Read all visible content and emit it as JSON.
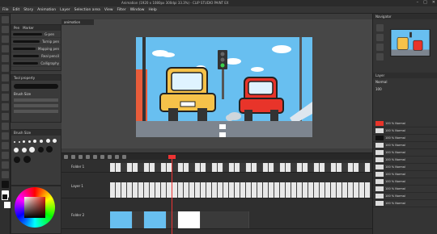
{
  "titlebar": {
    "title": "Animation (1920 x 1080px 300dpi 33.3%) - CLIP STUDIO PAINT EX"
  },
  "menu": [
    "File",
    "Edit",
    "Story",
    "Animation",
    "Layer",
    "Selection area",
    "View",
    "Filter",
    "Window",
    "Help"
  ],
  "window_controls": [
    "–",
    "□",
    "✕"
  ],
  "sub_tool": {
    "tabs": [
      "Pen",
      "Marker"
    ],
    "brushes": [
      {
        "name": "G-pen"
      },
      {
        "name": "Turnip pen"
      },
      {
        "name": "Mapping pen"
      },
      {
        "name": "Real pencil"
      },
      {
        "name": "Calligraphy"
      }
    ]
  },
  "tool_property": {
    "title": "Tool property",
    "brush_size_label": "Brush Size"
  },
  "brush_size_panel": {
    "title": "Brush Size"
  },
  "canvas": {
    "tab": "animation"
  },
  "timeline": {
    "tracks": [
      {
        "name": "Folder 1",
        "cells": "1-5 9 13 17"
      },
      {
        "name": "Layer 1",
        "cells": "1 4 7"
      },
      {
        "name": "Folder 2",
        "cells": "1 4 7"
      }
    ]
  },
  "navigator": {
    "title": "Navigator"
  },
  "layers": {
    "title": "Layer",
    "blend_mode": "Normal",
    "opacity": "100",
    "items": [
      {
        "name": "100 % Normal"
      },
      {
        "name": "100 % Normal"
      },
      {
        "name": "100 % Normal"
      },
      {
        "name": "100 % Normal"
      },
      {
        "name": "100 % Normal"
      },
      {
        "name": "100 % Normal"
      },
      {
        "name": "100 % Normal"
      },
      {
        "name": "100 % Normal"
      },
      {
        "name": "100 % Normal"
      },
      {
        "name": "100 % Normal"
      },
      {
        "name": "100 % Normal"
      },
      {
        "name": "100 % Normal"
      }
    ]
  },
  "colors": {
    "accent": "#e33333",
    "main_color": "#d21b1b"
  }
}
